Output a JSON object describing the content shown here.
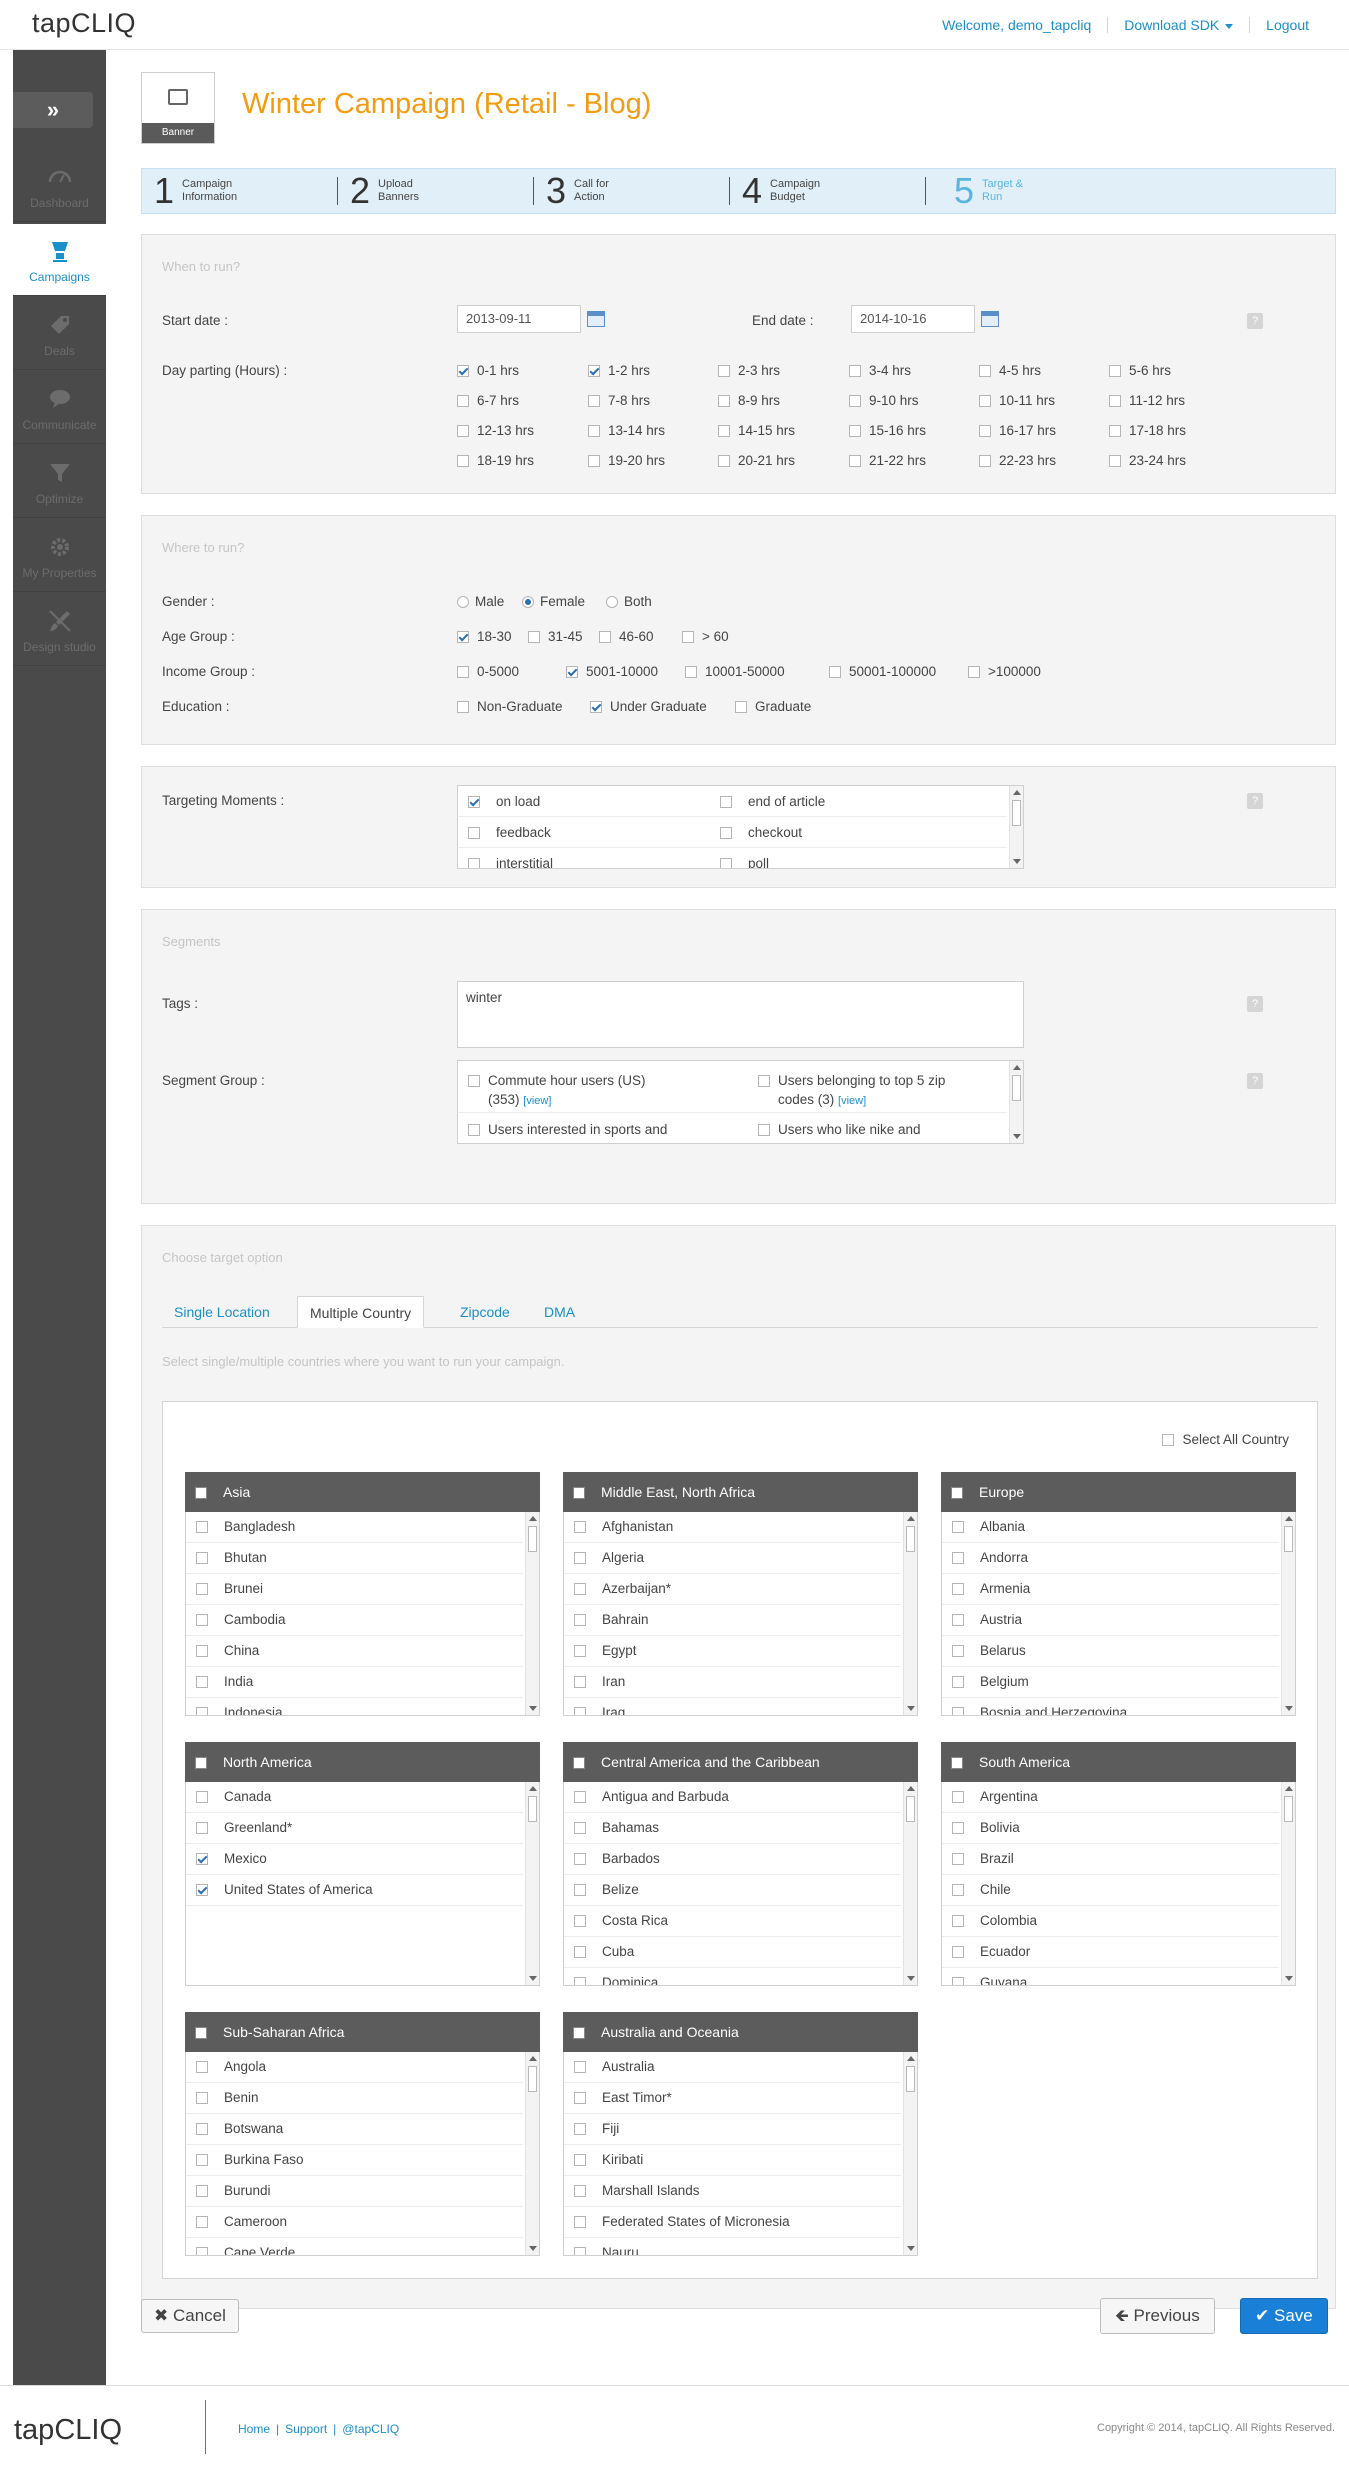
{
  "header": {
    "logo": "tapCLIQ",
    "welcome": "Welcome, demo_tapcliq",
    "download_sdk": "Download SDK",
    "logout": "Logout"
  },
  "sidebar": {
    "items": [
      {
        "label": "Dashboard",
        "icon": "gauge-icon",
        "active": false
      },
      {
        "label": "Campaigns",
        "icon": "megaphone-icon",
        "active": true
      },
      {
        "label": "Deals",
        "icon": "tag-icon",
        "active": false
      },
      {
        "label": "Communicate",
        "icon": "chat-icon",
        "active": false
      },
      {
        "label": "Optimize",
        "icon": "filter-icon",
        "active": false
      },
      {
        "label": "My Properties",
        "icon": "gear-icon",
        "active": false
      },
      {
        "label": "Design studio",
        "icon": "brush-icon",
        "active": false
      }
    ]
  },
  "campaign": {
    "banner_label": "Banner",
    "title": "Winter Campaign (Retail - Blog)"
  },
  "steps": [
    {
      "num": "1",
      "line1": "Campaign",
      "line2": "Information"
    },
    {
      "num": "2",
      "line1": "Upload",
      "line2": "Banners"
    },
    {
      "num": "3",
      "line1": "Call for",
      "line2": "Action"
    },
    {
      "num": "4",
      "line1": "Campaign",
      "line2": "Budget"
    },
    {
      "num": "5",
      "line1": "Target &",
      "line2": "Run"
    }
  ],
  "when": {
    "heading": "When to run?",
    "start_label": "Start date :",
    "start_value": "2013-09-11",
    "end_label": "End date :",
    "end_value": "2014-10-16",
    "dayparting_label": "Day parting (Hours) :",
    "hours": [
      {
        "label": "0-1 hrs",
        "checked": true
      },
      {
        "label": "1-2 hrs",
        "checked": true
      },
      {
        "label": "2-3 hrs",
        "checked": false
      },
      {
        "label": "3-4 hrs",
        "checked": false
      },
      {
        "label": "4-5 hrs",
        "checked": false
      },
      {
        "label": "5-6 hrs",
        "checked": false
      },
      {
        "label": "6-7 hrs",
        "checked": false
      },
      {
        "label": "7-8 hrs",
        "checked": false
      },
      {
        "label": "8-9 hrs",
        "checked": false
      },
      {
        "label": "9-10 hrs",
        "checked": false
      },
      {
        "label": "10-11 hrs",
        "checked": false
      },
      {
        "label": "11-12 hrs",
        "checked": false
      },
      {
        "label": "12-13 hrs",
        "checked": false
      },
      {
        "label": "13-14 hrs",
        "checked": false
      },
      {
        "label": "14-15 hrs",
        "checked": false
      },
      {
        "label": "15-16 hrs",
        "checked": false
      },
      {
        "label": "16-17 hrs",
        "checked": false
      },
      {
        "label": "17-18 hrs",
        "checked": false
      },
      {
        "label": "18-19 hrs",
        "checked": false
      },
      {
        "label": "19-20 hrs",
        "checked": false
      },
      {
        "label": "20-21 hrs",
        "checked": false
      },
      {
        "label": "21-22 hrs",
        "checked": false
      },
      {
        "label": "22-23 hrs",
        "checked": false
      },
      {
        "label": "23-24 hrs",
        "checked": false
      }
    ]
  },
  "where": {
    "heading": "Where to run?",
    "gender_label": "Gender :",
    "gender_options": [
      {
        "label": "Male",
        "checked": false
      },
      {
        "label": "Female",
        "checked": true
      },
      {
        "label": "Both",
        "checked": false
      }
    ],
    "age_label": "Age Group :",
    "age_options": [
      {
        "label": "18-30",
        "checked": true
      },
      {
        "label": "31-45",
        "checked": false
      },
      {
        "label": "46-60",
        "checked": false
      },
      {
        "label": "> 60",
        "checked": false
      }
    ],
    "income_label": "Income Group :",
    "income_options": [
      {
        "label": "0-5000",
        "checked": false
      },
      {
        "label": "5001-10000",
        "checked": true
      },
      {
        "label": "10001-50000",
        "checked": false
      },
      {
        "label": "50001-100000",
        "checked": false
      },
      {
        "label": ">100000",
        "checked": false
      }
    ],
    "education_label": "Education :",
    "education_options": [
      {
        "label": "Non-Graduate",
        "checked": false
      },
      {
        "label": "Under Graduate",
        "checked": true
      },
      {
        "label": "Graduate",
        "checked": false
      }
    ]
  },
  "moments": {
    "label": "Targeting Moments :",
    "items": [
      {
        "label": "on load",
        "checked": true
      },
      {
        "label": "end of article",
        "checked": false
      },
      {
        "label": "feedback",
        "checked": false
      },
      {
        "label": "checkout",
        "checked": false
      },
      {
        "label": "interstitial",
        "checked": false
      },
      {
        "label": "poll",
        "checked": false
      }
    ]
  },
  "segments": {
    "heading": "Segments",
    "tags_label": "Tags :",
    "tags_value": "winter",
    "group_label": "Segment Group :",
    "view_label": "[view]",
    "groups": [
      {
        "line1": "Commute hour users (US)",
        "line2": "(353)",
        "has_view": true,
        "checked": false
      },
      {
        "line1": "Users belonging to top 5 zip",
        "line2": "codes (3)",
        "has_view": true,
        "checked": false
      },
      {
        "line1": "Users interested in sports and",
        "line2": "",
        "has_view": false,
        "checked": false
      },
      {
        "line1": "Users who like nike and",
        "line2": "",
        "has_view": false,
        "checked": false
      }
    ]
  },
  "target": {
    "heading": "Choose target option",
    "tabs": [
      {
        "label": "Single Location",
        "active": false
      },
      {
        "label": "Multiple Country",
        "active": true
      },
      {
        "label": "Zipcode",
        "active": false
      },
      {
        "label": "DMA",
        "active": false
      }
    ],
    "hint": "Select single/multiple countries where you want to run your campaign.",
    "select_all": "Select All Country",
    "regions": [
      {
        "name": "Asia",
        "countries": [
          {
            "label": "Bangladesh",
            "checked": false
          },
          {
            "label": "Bhutan",
            "checked": false
          },
          {
            "label": "Brunei",
            "checked": false
          },
          {
            "label": "Cambodia",
            "checked": false
          },
          {
            "label": "China",
            "checked": false
          },
          {
            "label": "India",
            "checked": false
          },
          {
            "label": "Indonesia",
            "checked": false
          }
        ]
      },
      {
        "name": "Middle East, North Africa",
        "countries": [
          {
            "label": "Afghanistan",
            "checked": false
          },
          {
            "label": "Algeria",
            "checked": false
          },
          {
            "label": "Azerbaijan*",
            "checked": false
          },
          {
            "label": "Bahrain",
            "checked": false
          },
          {
            "label": "Egypt",
            "checked": false
          },
          {
            "label": "Iran",
            "checked": false
          },
          {
            "label": "Iraq",
            "checked": false
          }
        ]
      },
      {
        "name": "Europe",
        "countries": [
          {
            "label": "Albania",
            "checked": false
          },
          {
            "label": "Andorra",
            "checked": false
          },
          {
            "label": "Armenia",
            "checked": false
          },
          {
            "label": "Austria",
            "checked": false
          },
          {
            "label": "Belarus",
            "checked": false
          },
          {
            "label": "Belgium",
            "checked": false
          },
          {
            "label": "Bosnia and Herzegovina",
            "checked": false
          }
        ]
      },
      {
        "name": "North America",
        "countries": [
          {
            "label": "Canada",
            "checked": false
          },
          {
            "label": "Greenland*",
            "checked": false
          },
          {
            "label": "Mexico",
            "checked": true
          },
          {
            "label": "United States of America",
            "checked": true
          }
        ]
      },
      {
        "name": "Central America and the Caribbean",
        "countries": [
          {
            "label": "Antigua and Barbuda",
            "checked": false
          },
          {
            "label": "Bahamas",
            "checked": false
          },
          {
            "label": "Barbados",
            "checked": false
          },
          {
            "label": "Belize",
            "checked": false
          },
          {
            "label": "Costa Rica",
            "checked": false
          },
          {
            "label": "Cuba",
            "checked": false
          },
          {
            "label": "Dominica",
            "checked": false
          }
        ]
      },
      {
        "name": "South America",
        "countries": [
          {
            "label": "Argentina",
            "checked": false
          },
          {
            "label": "Bolivia",
            "checked": false
          },
          {
            "label": "Brazil",
            "checked": false
          },
          {
            "label": "Chile",
            "checked": false
          },
          {
            "label": "Colombia",
            "checked": false
          },
          {
            "label": "Ecuador",
            "checked": false
          },
          {
            "label": "Guyana",
            "checked": false
          }
        ]
      },
      {
        "name": "Sub-Saharan Africa",
        "countries": [
          {
            "label": "Angola",
            "checked": false
          },
          {
            "label": "Benin",
            "checked": false
          },
          {
            "label": "Botswana",
            "checked": false
          },
          {
            "label": "Burkina Faso",
            "checked": false
          },
          {
            "label": "Burundi",
            "checked": false
          },
          {
            "label": "Cameroon",
            "checked": false
          },
          {
            "label": "Cape Verde",
            "checked": false
          }
        ]
      },
      {
        "name": "Australia and Oceania",
        "countries": [
          {
            "label": "Australia",
            "checked": false
          },
          {
            "label": "East Timor*",
            "checked": false
          },
          {
            "label": "Fiji",
            "checked": false
          },
          {
            "label": "Kiribati",
            "checked": false
          },
          {
            "label": "Marshall Islands",
            "checked": false
          },
          {
            "label": "Federated States of Micronesia",
            "checked": false
          },
          {
            "label": "Nauru",
            "checked": false
          }
        ]
      }
    ]
  },
  "actions": {
    "cancel": "Cancel",
    "previous": "Previous",
    "save": "Save"
  },
  "footer": {
    "logo": "tapCLIQ",
    "links": [
      "Home",
      "Support",
      "@tapCLIQ"
    ],
    "copyright": "Copyright © 2014, tapCLIQ. All Rights Reserved."
  },
  "colors": {
    "accent": "#1a8fc9",
    "title": "#f39c12",
    "sidebar": "#4a4a4a",
    "primary_button": "#1a7fd6"
  }
}
